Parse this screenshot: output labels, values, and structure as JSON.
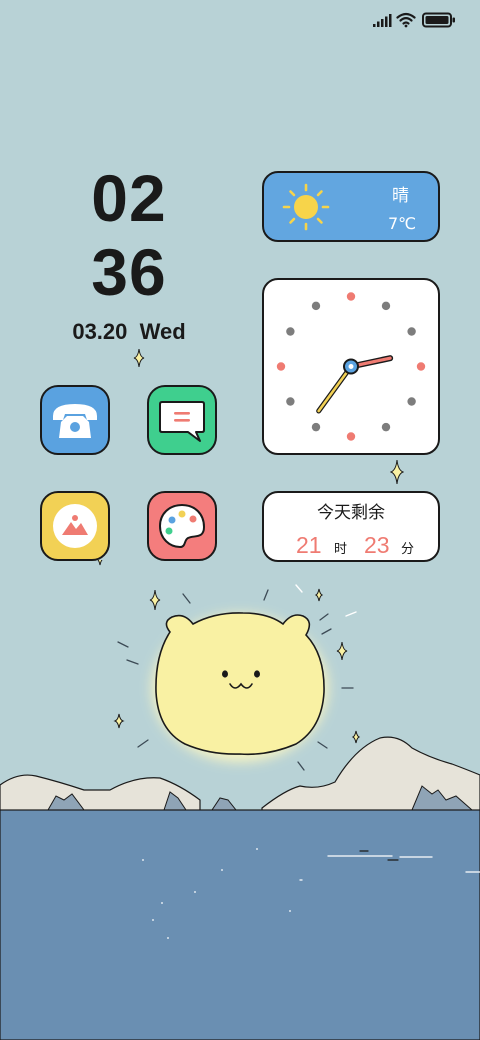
{
  "status_bar": {
    "icons": [
      "signal-icon",
      "wifi-icon",
      "battery-icon"
    ]
  },
  "clock": {
    "hour": "02",
    "minute": "36",
    "date": "03.20",
    "weekday": "Wed"
  },
  "apps": [
    {
      "name": "phone",
      "icon": "phone-icon",
      "color": "#5aa2e0"
    },
    {
      "name": "messages",
      "icon": "message-icon",
      "color": "#3fcf8e"
    },
    {
      "name": "gallery",
      "icon": "gallery-icon",
      "color": "#f2d155"
    },
    {
      "name": "themes",
      "icon": "palette-icon",
      "color": "#f47d7d"
    }
  ],
  "weather": {
    "condition": "晴",
    "temperature": "7℃",
    "icon": "sun-icon"
  },
  "analog_clock": {
    "hour": 2,
    "minute": 36
  },
  "countdown": {
    "title": "今天剩余",
    "hours": "21",
    "hours_unit": "时",
    "minutes": "23",
    "minutes_unit": "分"
  },
  "colors": {
    "background": "#b8d2d6",
    "accent_red": "#ef7b72",
    "sea": "#6a8fb2",
    "sun_bear": "#f9f1a3"
  }
}
